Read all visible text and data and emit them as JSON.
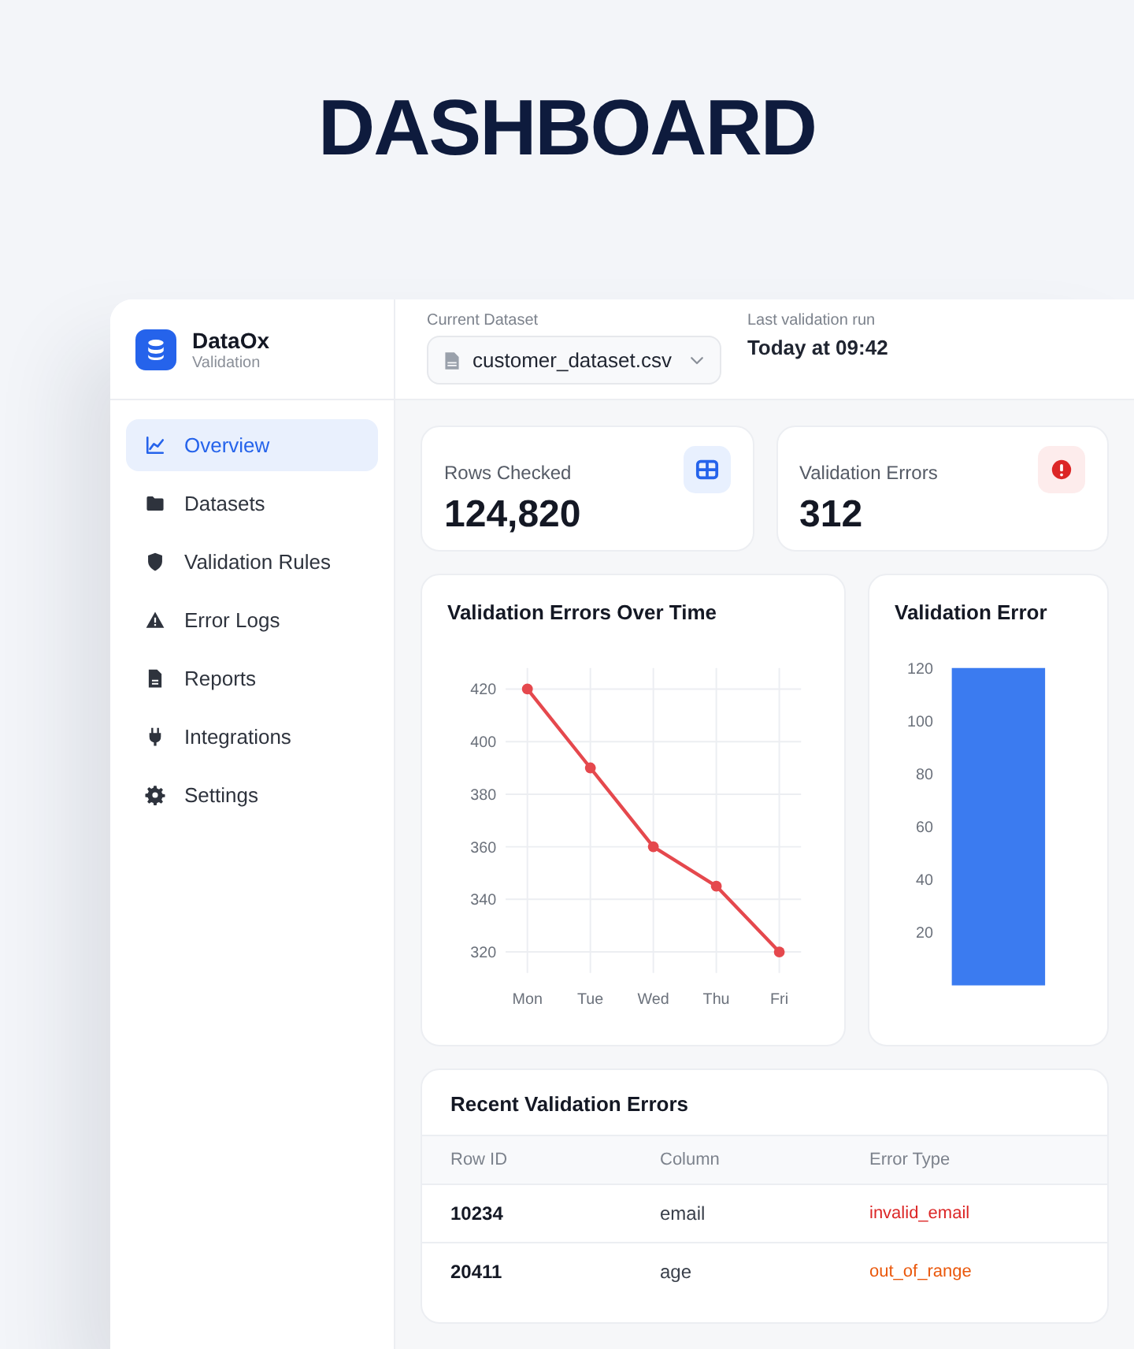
{
  "page_title": "DASHBOARD",
  "sidebar": {
    "brand": {
      "name": "DataOx",
      "subtitle": "Validation"
    },
    "items": [
      {
        "label": "Overview",
        "selected": true
      },
      {
        "label": "Datasets",
        "selected": false
      },
      {
        "label": "Validation Rules",
        "selected": false
      },
      {
        "label": "Error Logs",
        "selected": false
      },
      {
        "label": "Reports",
        "selected": false
      },
      {
        "label": "Integrations",
        "selected": false
      },
      {
        "label": "Settings",
        "selected": false
      }
    ]
  },
  "header": {
    "dataset": {
      "label": "Current Dataset",
      "value": "customer_dataset.csv"
    },
    "last_run": {
      "label": "Last validation run",
      "value": "Today at 09:42"
    }
  },
  "stats": [
    {
      "label": "Rows Checked",
      "value": "124,820"
    },
    {
      "label": "Validation Errors",
      "value": "312"
    }
  ],
  "line_chart": {
    "chart_data": {
      "type": "line",
      "title": "Validation Errors Over Time",
      "x": [
        "Mon",
        "Tue",
        "Wed",
        "Thu",
        "Fri"
      ],
      "values": [
        420,
        390,
        360,
        345,
        320
      ],
      "ylim": [
        312,
        428
      ],
      "yticks": [
        320,
        340,
        360,
        380,
        400,
        420
      ],
      "grid": true,
      "marker": true
    }
  },
  "bar_panel": {
    "title": "Validation Error",
    "axis_labels": [
      "120",
      "100",
      "80",
      "60",
      "40",
      "20"
    ]
  },
  "table": {
    "title": "Recent Validation Errors",
    "columns": [
      "Row ID",
      "Column",
      "Error Type"
    ],
    "rows": [
      {
        "row_id": "10234",
        "column": "email",
        "error_type": "invalid_email",
        "color": "#dc2626"
      },
      {
        "row_id": "20411",
        "column": "age",
        "error_type": "out_of_range",
        "color": "#ea580c"
      }
    ]
  }
}
